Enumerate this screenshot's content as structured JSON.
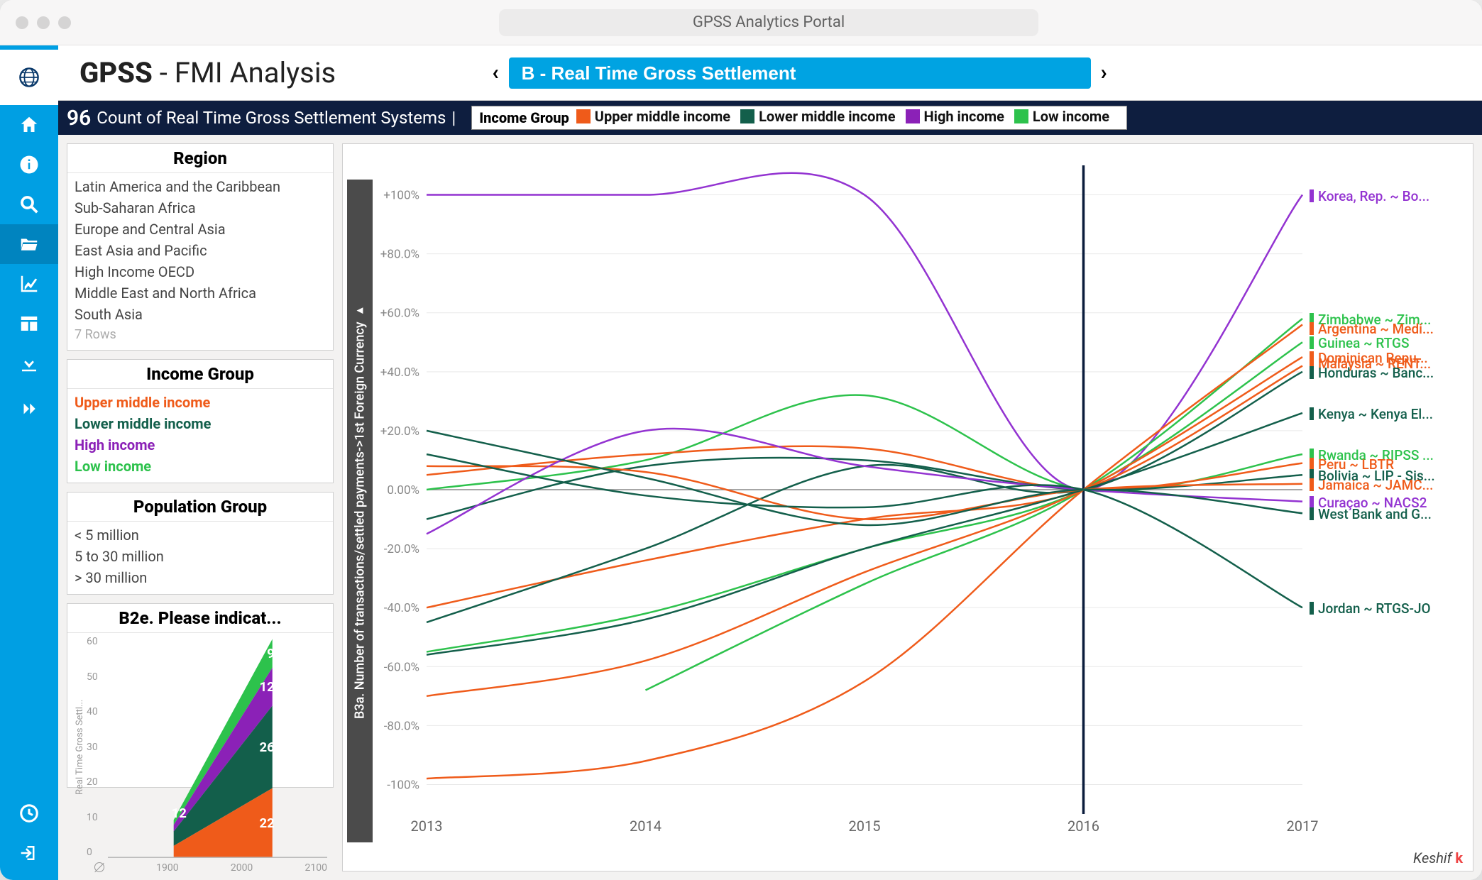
{
  "window_title": "GPSS Analytics Portal",
  "header": {
    "title_bold": "GPSS",
    "title_rest": " - FMI Analysis",
    "selector_value": "B - Real Time Gross Settlement"
  },
  "subheader": {
    "count": "96",
    "text": "Count of Real Time Gross Settlement Systems",
    "legend_title": "Income Group",
    "legend_items": [
      {
        "label": "Upper middle income",
        "color": "#ef5b1a"
      },
      {
        "label": "Lower middle income",
        "color": "#135f4b"
      },
      {
        "label": "High income",
        "color": "#8b21b7"
      },
      {
        "label": "Low income",
        "color": "#2dc24c"
      }
    ]
  },
  "colors": {
    "orange": "#ef5b1a",
    "teal": "#135f4b",
    "purple": "#9333d1",
    "green": "#2dc24c"
  },
  "facets": {
    "region": {
      "title": "Region",
      "items": [
        "Latin America and the Caribbean",
        "Sub-Saharan Africa",
        "Europe and Central Asia",
        "East Asia and Pacific",
        "High Income OECD",
        "Middle East and North Africa",
        "South Asia"
      ],
      "footer": "7 Rows"
    },
    "income_group": {
      "title": "Income Group",
      "items": [
        {
          "label": "Upper middle income",
          "color": "orange"
        },
        {
          "label": "Lower middle income",
          "color": "teal"
        },
        {
          "label": "High income",
          "color": "purple"
        },
        {
          "label": "Low income",
          "color": "green"
        }
      ]
    },
    "population": {
      "title": "Population Group",
      "items": [
        "< 5 million",
        "5 to 30 million",
        "> 30 million"
      ]
    },
    "mini": {
      "title": "B2e. Please indicat...",
      "y_ticks": [
        "60",
        "50",
        "40",
        "30",
        "20",
        "10",
        "0"
      ],
      "x_ticks": [
        "1900",
        "2000",
        "2100"
      ],
      "ylabel": "Real Time Gross Settl...",
      "value_labels": [
        "9",
        "12",
        "26",
        "22",
        "12"
      ]
    }
  },
  "chart_data": {
    "type": "line",
    "ylabel": "B3a. Number of transactions/settled payments->1st Foreign Currency  ▸",
    "x": [
      2013,
      2014,
      2015,
      2016,
      2017
    ],
    "x_ticks": [
      "2013",
      "2014",
      "2015",
      "2016",
      "2017"
    ],
    "ylim": [
      -110,
      110
    ],
    "y_ticks": [
      "+100%",
      "+80.0%",
      "+60.0%",
      "+40.0%",
      "+20.0%",
      "0.00%",
      "-20.0%",
      "-40.0%",
      "-60.0%",
      "-80.0%",
      "-100%"
    ],
    "ref_x": 2016,
    "series": [
      {
        "name": "Korea, Rep. ~ Bo...",
        "color": "#9333d1",
        "values": [
          100,
          100,
          100,
          0,
          100
        ]
      },
      {
        "name": "Zimbabwe ~ Zim...",
        "color": "#2dc24c",
        "values": [
          null,
          -68,
          -32,
          0,
          58
        ]
      },
      {
        "name": "Argentina ~ Medi...",
        "color": "#ef5b1a",
        "values": [
          -98,
          -92,
          -65,
          0,
          56
        ]
      },
      {
        "name": "Guinea ~ RTGS",
        "color": "#2dc24c",
        "values": [
          -55,
          -42,
          -20,
          0,
          50
        ]
      },
      {
        "name": "Dominican Repu...",
        "color": "#ef5b1a",
        "values": [
          -70,
          -58,
          -28,
          0,
          45
        ]
      },
      {
        "name": "Malaysia ~ RENT...",
        "color": "#ef5b1a",
        "values": [
          -40,
          -24,
          -10,
          0,
          42
        ]
      },
      {
        "name": "Honduras ~ Banc...",
        "color": "#135f4b",
        "values": [
          -45,
          -20,
          8,
          0,
          40
        ]
      },
      {
        "name": "Kenya ~ Kenya El...",
        "color": "#135f4b",
        "values": [
          -56,
          -44,
          -20,
          0,
          26
        ]
      },
      {
        "name": "Rwanda ~ RIPSS ...",
        "color": "#2dc24c",
        "values": [
          0,
          10,
          32,
          0,
          12
        ]
      },
      {
        "name": "Peru ~ LBTR",
        "color": "#ef5b1a",
        "values": [
          5,
          12,
          14,
          0,
          9
        ]
      },
      {
        "name": "Bolivia ~ LIP - Sis...",
        "color": "#135f4b",
        "values": [
          -10,
          8,
          10,
          0,
          5
        ]
      },
      {
        "name": "Jamaica ~ JAMC...",
        "color": "#ef5b1a",
        "values": [
          8,
          6,
          -10,
          0,
          2
        ]
      },
      {
        "name": "Curaçao ~ NACS2",
        "color": "#9333d1",
        "values": [
          -15,
          20,
          8,
          0,
          -4
        ]
      },
      {
        "name": "West Bank and G...",
        "color": "#135f4b",
        "values": [
          20,
          4,
          -12,
          0,
          -8
        ]
      },
      {
        "name": "Jordan ~ RTGS-JO",
        "color": "#135f4b",
        "values": [
          12,
          -2,
          -6,
          0,
          -40
        ]
      }
    ],
    "end_labels_y": [
      100,
      58,
      55,
      50,
      45,
      43,
      40,
      26,
      12,
      9,
      5,
      2,
      -4,
      -8,
      -40
    ]
  },
  "mini_chart_data": {
    "type": "area",
    "x": [
      1960,
      2050
    ],
    "stack_at_2050": [
      22,
      26,
      12,
      9
    ],
    "colors": [
      "#ef5b1a",
      "#135f4b",
      "#8b21b7",
      "#2dc24c"
    ],
    "start_label": "12"
  },
  "brand": "Keshif"
}
